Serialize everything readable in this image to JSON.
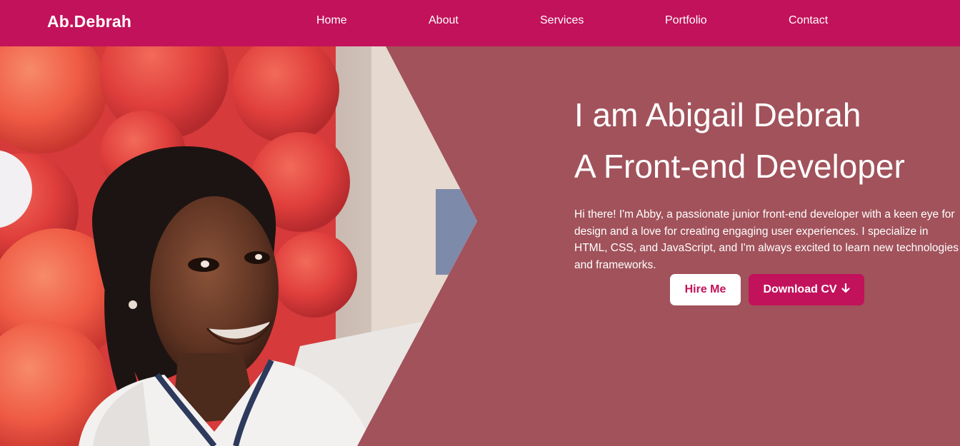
{
  "brand": {
    "logo": "Ab.Debrah"
  },
  "nav": {
    "items": [
      {
        "label": "Home"
      },
      {
        "label": "About"
      },
      {
        "label": "Services"
      },
      {
        "label": "Portfolio"
      },
      {
        "label": "Contact"
      }
    ]
  },
  "hero": {
    "title_line1": "I am Abigail Debrah",
    "title_line2": "A Front-end Developer",
    "intro": "Hi there! I'm Abby, a passionate junior front-end developer with a keen eye for design and a love for creating engaging user experiences. I specialize in HTML, CSS, and JavaScript, and I'm always excited to learn new technologies and frameworks.",
    "hire_label": "Hire Me",
    "cv_label": "Download CV",
    "cv_icon": "arrow-down-icon"
  },
  "colors": {
    "nav_bg": "#c2125b",
    "hero_bg": "#a1525b",
    "button_primary": "#c2125b",
    "button_secondary": "#ffffff"
  }
}
